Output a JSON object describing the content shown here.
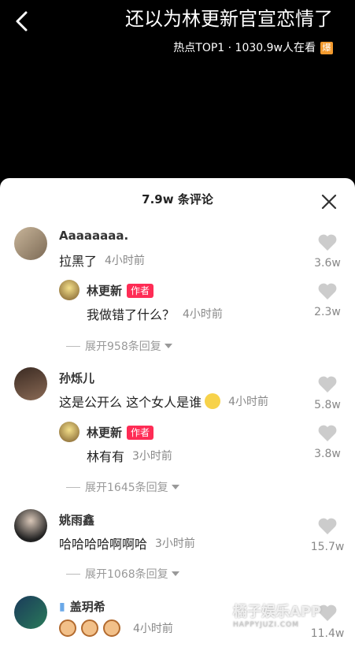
{
  "header": {
    "title": "还以为林更新官宣恋情了",
    "hot_label": "热点TOP1 · 1030.9w人在看",
    "hot_icon_text": "爆"
  },
  "sheet": {
    "title": "7.9w 条评论"
  },
  "comments": [
    {
      "name": "Aaaaaaaa.",
      "text": "拉黑了",
      "time": "4小时前",
      "likes": "3.6w",
      "reply": {
        "name": "林更新",
        "tag": "作者",
        "text": "我做错了什么？",
        "time": "4小时前",
        "likes": "2.3w"
      },
      "expand": "展开958条回复"
    },
    {
      "name": "孙烁儿",
      "text": "这是公开么 这个女人是谁",
      "time": "4小时前",
      "likes": "5.8w",
      "reply": {
        "name": "林更新",
        "tag": "作者",
        "text": "林有有",
        "time": "3小时前",
        "likes": "3.8w"
      },
      "expand": "展开1645条回复"
    },
    {
      "name": "姚雨鑫",
      "text": "哈哈哈哈啊啊哈",
      "time": "3小时前",
      "likes": "15.7w",
      "expand": "展开1068条回复"
    },
    {
      "name": "盖玥希",
      "text": "",
      "time": "4小时前",
      "likes": "11.4w"
    }
  ],
  "watermark": {
    "main": "橘子娱乐APP",
    "sub": "HAPPYJUZI.COM"
  },
  "colors": {
    "accent": "#fe2c55",
    "background": "#000000",
    "sheet": "#ffffff"
  }
}
